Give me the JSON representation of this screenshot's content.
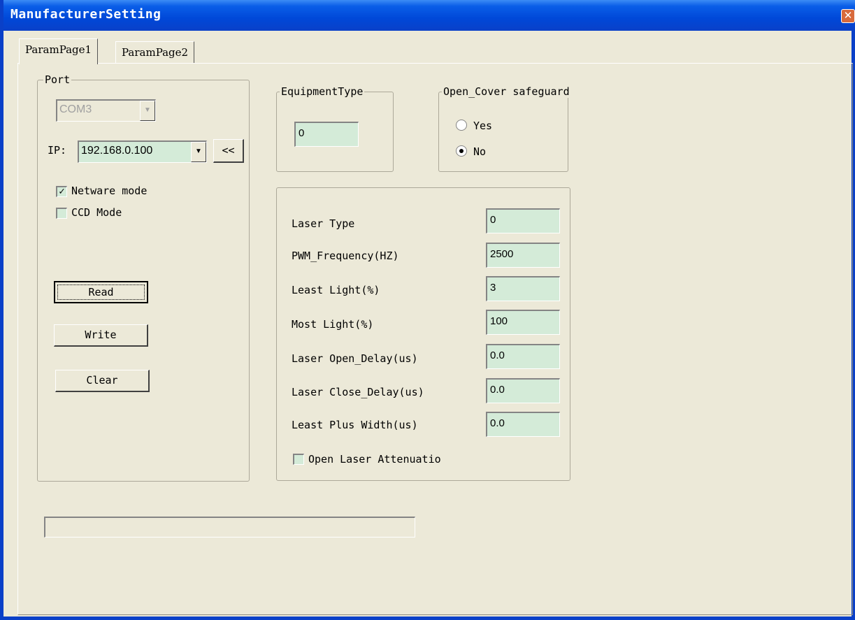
{
  "window": {
    "title": "ManufacturerSetting",
    "close_glyph": "✕"
  },
  "tabs": [
    {
      "label": "ParamPage1"
    },
    {
      "label": "ParamPage2"
    }
  ],
  "port": {
    "legend": "Port",
    "com_value": "COM3",
    "ip_label": "IP:",
    "ip_value": "192.168.0.100",
    "ip_button": "<<",
    "netware_mode_label": "Netware mode",
    "netware_mode_checked": true,
    "ccd_mode_label": "CCD Mode",
    "ccd_mode_checked": false,
    "read_button": "Read",
    "write_button": "Write",
    "clear_button": "Clear"
  },
  "equipment": {
    "legend": "EquipmentType",
    "value": "0"
  },
  "cover": {
    "legend": "Open_Cover safeguard",
    "yes_label": "Yes",
    "no_label": "No",
    "selected": "No"
  },
  "laser": {
    "rows": [
      {
        "label": "Laser Type",
        "value": "0"
      },
      {
        "label": "PWM_Frequency(HZ)",
        "value": "2500"
      },
      {
        "label": "Least Light(%)",
        "value": "3"
      },
      {
        "label": "Most Light(%)",
        "value": "100"
      },
      {
        "label": "Laser Open_Delay(us)",
        "value": "0.0"
      },
      {
        "label": "Laser Close_Delay(us)",
        "value": "0.0"
      },
      {
        "label": "Least Plus Width(us)",
        "value": "0.0"
      }
    ],
    "attenuation_label": "Open Laser Attenuatio",
    "attenuation_checked": false
  },
  "status": {
    "value": ""
  },
  "colors": {
    "titlebar": "#0a40c8",
    "dialog_bg": "#ece9d8",
    "field_bg": "#d4ebd8"
  },
  "icons": {
    "close": "close-icon",
    "dropdown": "chevron-down-icon",
    "check": "checkmark-icon"
  }
}
